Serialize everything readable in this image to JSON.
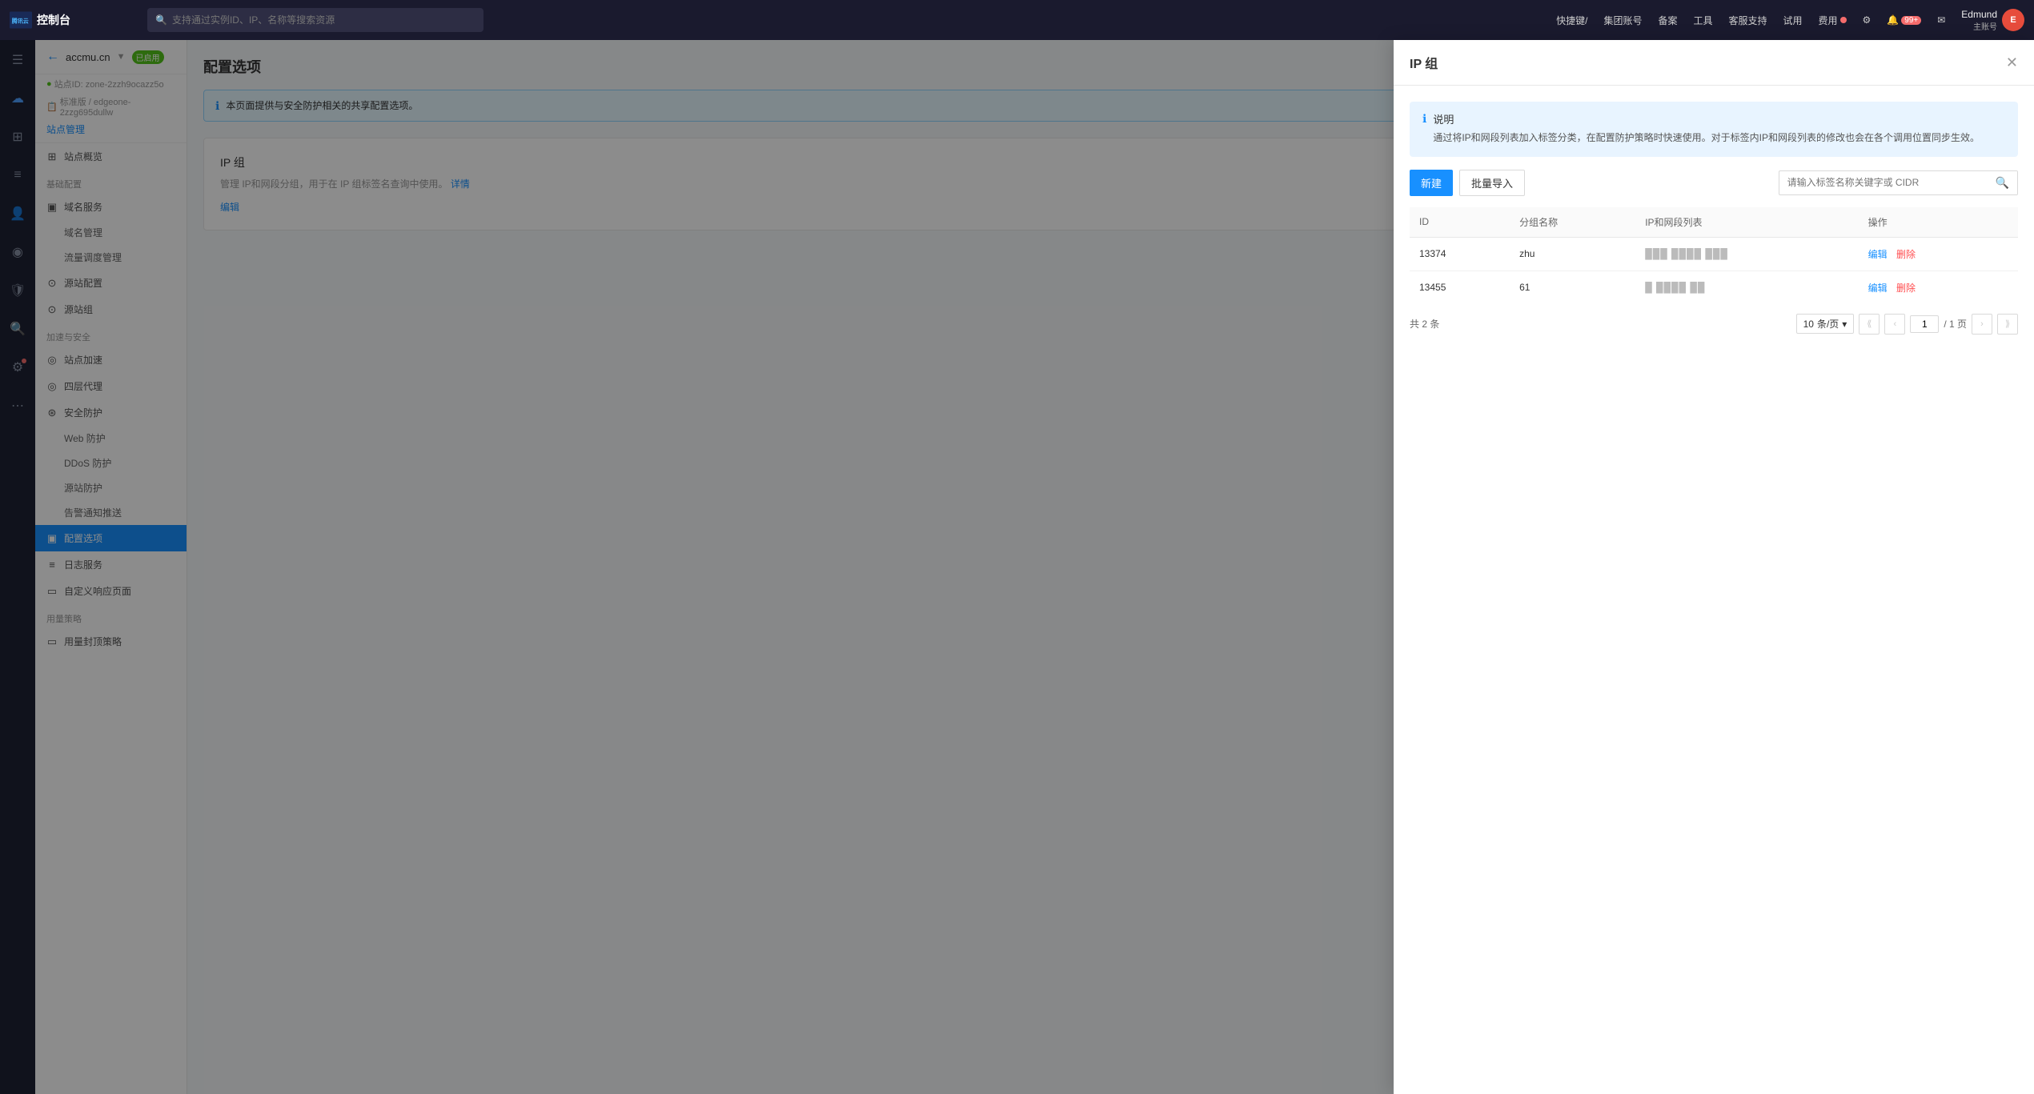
{
  "app": {
    "name": "腾讯云",
    "console_label": "控制台"
  },
  "topnav": {
    "search_placeholder": "支持通过实例ID、IP、名称等搜索资源",
    "shortcut_label": "快捷键/",
    "group_label": "集团账号",
    "backup_label": "备案",
    "tools_label": "工具",
    "support_label": "客服支持",
    "trial_label": "试用",
    "fee_label": "费用",
    "badge_count": "99+",
    "user_name": "Edmund",
    "user_sub": "主账号",
    "user_initials": "E"
  },
  "sidebar": {
    "back_text": "←",
    "site_name": "accmu.cn",
    "site_status": "已启用",
    "site_id": "站点ID: zone-2zzh9ocazz5o",
    "site_plan": "标准版 / edgeone-2zzg695dullw",
    "site_manage": "站点管理",
    "sections": [
      {
        "label": "",
        "items": [
          {
            "id": "overview",
            "icon": "⊞",
            "label": "站点概览",
            "active": false
          }
        ]
      },
      {
        "label": "基础配置",
        "items": [
          {
            "id": "domain-service",
            "icon": "▣",
            "label": "域名服务",
            "active": false
          },
          {
            "id": "domain-manage",
            "sub": true,
            "label": "域名管理",
            "active": false
          },
          {
            "id": "traffic",
            "sub": true,
            "label": "流量调度管理",
            "active": false
          }
        ]
      },
      {
        "label": "",
        "items": [
          {
            "id": "origin-config",
            "icon": "⊙",
            "label": "源站配置",
            "active": false
          },
          {
            "id": "origin-group",
            "icon": "⊙",
            "label": "源站组",
            "active": false
          }
        ]
      },
      {
        "label": "加速与安全",
        "items": [
          {
            "id": "site-accel",
            "icon": "◎",
            "label": "站点加速",
            "active": false
          },
          {
            "id": "l4-proxy",
            "icon": "◎",
            "label": "四层代理",
            "active": false
          },
          {
            "id": "security",
            "icon": "⊛",
            "label": "安全防护",
            "active": false
          },
          {
            "id": "web-protect",
            "sub": true,
            "label": "Web 防护",
            "active": false
          },
          {
            "id": "ddos-protect",
            "sub": true,
            "label": "DDoS 防护",
            "active": false
          },
          {
            "id": "origin-protect",
            "sub": true,
            "label": "源站防护",
            "active": false
          },
          {
            "id": "alert-push",
            "sub": true,
            "label": "告警通知推送",
            "active": false
          },
          {
            "id": "config-options",
            "icon": "▣",
            "label": "配置选项",
            "active": true
          }
        ]
      },
      {
        "label": "",
        "items": [
          {
            "id": "log-service",
            "icon": "≡",
            "label": "日志服务",
            "active": false
          },
          {
            "id": "custom-response",
            "icon": "▭",
            "label": "自定义响应页面",
            "active": false
          }
        ]
      },
      {
        "label": "用量策略",
        "items": [
          {
            "id": "traffic-limit",
            "icon": "▭",
            "label": "用量封顶策略",
            "active": false
          }
        ]
      }
    ]
  },
  "main": {
    "page_title": "配置选项",
    "info_banner": "本页面提供与安全防护相关的共享配置选项。",
    "config_section": {
      "title": "IP 组",
      "desc": "管理 IP和网段分组，用于在 IP 组标签名查询中使用。",
      "detail_link": "详情",
      "edit_link": "编辑"
    }
  },
  "modal": {
    "title": "IP 组",
    "close_icon": "✕",
    "info_title": "说明",
    "info_text": "通过将IP和网段列表加入标签分类，在配置防护策略时快速使用。对于标签内IP和网段列表的修改也会在各个调用位置同步生效。",
    "toolbar": {
      "new_btn": "新建",
      "import_btn": "批量导入",
      "search_placeholder": "请输入标签名称关键字或 CIDR"
    },
    "table": {
      "columns": [
        "ID",
        "分组名称",
        "IP和网段列表",
        "操作"
      ],
      "rows": [
        {
          "id": "13374",
          "name": "zhu",
          "ip_list": "███ ████ ███",
          "actions": [
            "编辑",
            "删除"
          ]
        },
        {
          "id": "13455",
          "name": "61",
          "ip_list": "█ ████ ██",
          "actions": [
            "编辑",
            "删除"
          ]
        }
      ]
    },
    "pagination": {
      "total_text": "共 2 条",
      "page_size": "10",
      "page_size_unit": "条/页",
      "current_page": "1",
      "total_pages": "1",
      "total_pages_text": "/ 1 页"
    }
  }
}
